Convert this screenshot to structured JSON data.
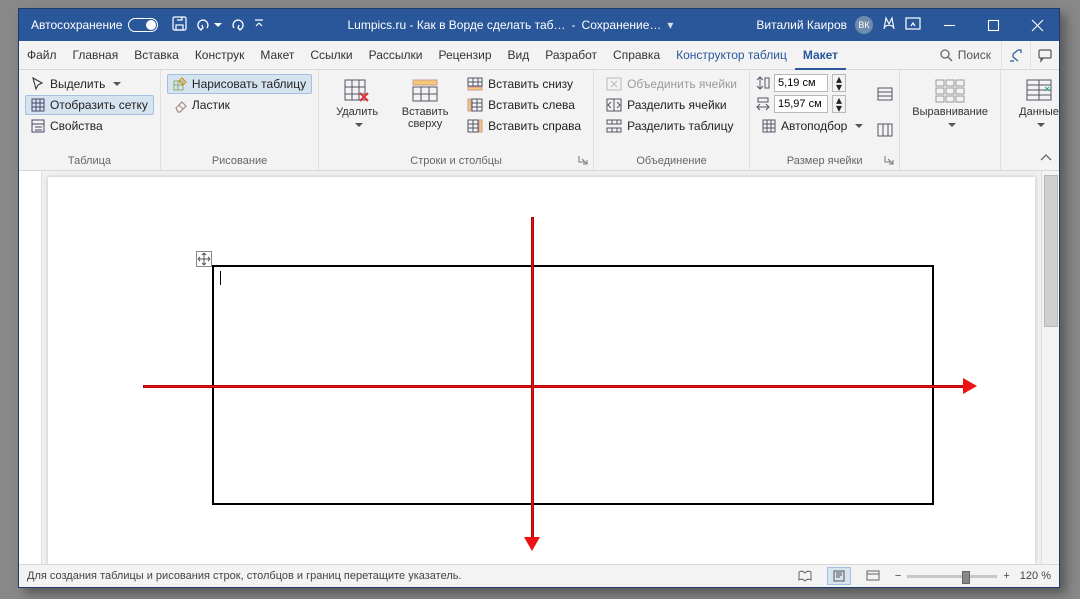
{
  "title": {
    "autosave": "Автосохранение",
    "doc": "Lumpics.ru - Как в Ворде сделать таб…",
    "saving": "Сохранение… ",
    "user": "Виталий Каиров",
    "initials": "ВК"
  },
  "tabs": {
    "file": "Файл",
    "home": "Главная",
    "insert": "Вставка",
    "design": "Конструк",
    "layout": "Макет",
    "refs": "Ссылки",
    "mail": "Рассылки",
    "review": "Рецензир",
    "view": "Вид",
    "dev": "Разработ",
    "help": "Справка",
    "tdesign": "Конструктор таблиц",
    "tlayout": "Макет",
    "search": "Поиск"
  },
  "grp": {
    "table": {
      "label": "Таблица",
      "select": "Выделить",
      "grid": "Отобразить сетку",
      "props": "Свойства"
    },
    "draw": {
      "label": "Рисование",
      "draw": "Нарисовать таблицу",
      "eraser": "Ластик"
    },
    "rc": {
      "label": "Строки и столбцы",
      "delete": "Удалить",
      "above": "Вставить сверху",
      "below": "Вставить снизу",
      "left": "Вставить слева",
      "right": "Вставить справа"
    },
    "merge": {
      "label": "Объединение",
      "mergec": "Объединить ячейки",
      "splitc": "Разделить ячейки",
      "splitt": "Разделить таблицу"
    },
    "size": {
      "label": "Размер ячейки",
      "h": "5,19 см",
      "w": "15,97 см",
      "autofit": "Автоподбор"
    },
    "align": {
      "label": "Выравнивание"
    },
    "data": {
      "label": "Данные"
    }
  },
  "status": {
    "hint": "Для создания таблицы и рисования строк, столбцов и границ перетащите указатель.",
    "zoom": "120 %"
  }
}
